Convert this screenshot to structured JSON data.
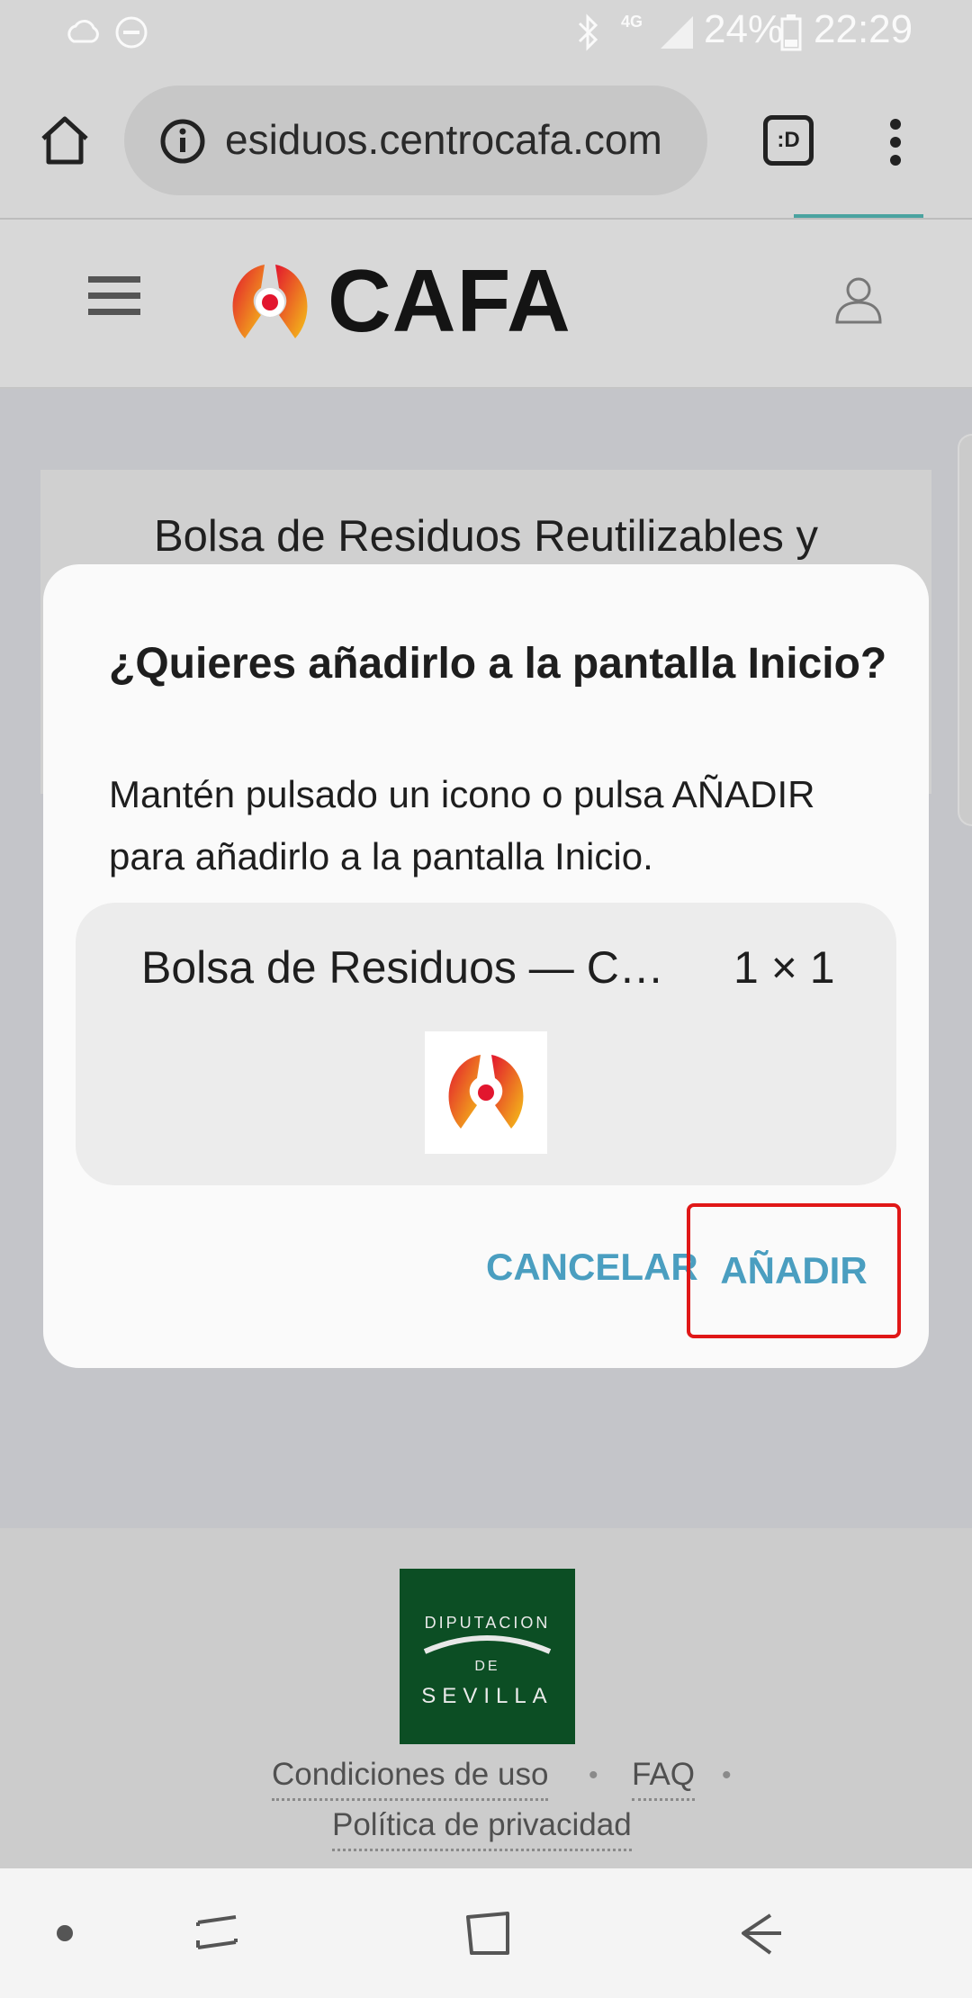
{
  "status_bar": {
    "network": "4G",
    "battery": "24%",
    "time": "22:29"
  },
  "browser": {
    "url": "esiduos.centrocafa.com",
    "tab_switcher_label": ":D"
  },
  "site": {
    "logo_text": "CAFA",
    "page_title": "Bolsa de Residuos Reutilizables y"
  },
  "dialog": {
    "title": "¿Quieres añadirlo a la pantalla Inicio?",
    "body": "Mantén pulsado un icono o pulsa AÑADIR para añadirlo a la pantalla Inicio.",
    "app_name": "Bolsa de Residuos — C…",
    "app_size": "1 × 1",
    "cancel_label": "CANCELAR",
    "add_label": "AÑADIR"
  },
  "footer": {
    "sponsor_logo_line1": "DIPUTACION",
    "sponsor_logo_line2": "DE",
    "sponsor_logo_line3": "SEVILLA",
    "link_terms": "Condiciones de uso",
    "link_faq": "FAQ",
    "link_privacy": "Política de privacidad"
  },
  "colors": {
    "accent": "#4a9ec0",
    "highlight_box": "#e01717",
    "sevilla_green": "#0c4e24"
  }
}
